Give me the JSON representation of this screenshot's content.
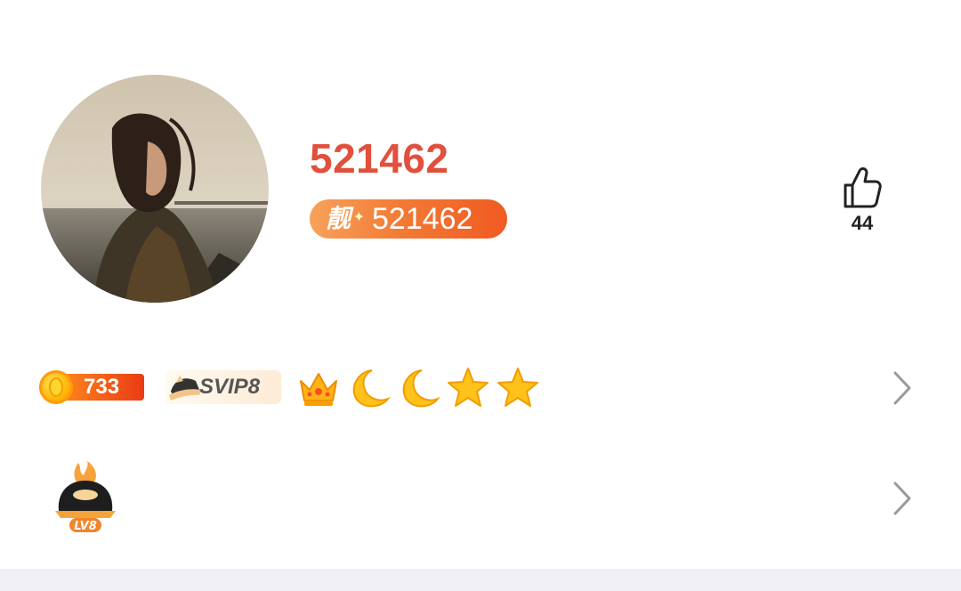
{
  "profile": {
    "username": "521462",
    "pretty_id": {
      "prefix": "靓",
      "number": "521462"
    },
    "likes": {
      "icon": "thumbs-up-icon",
      "count": "44"
    }
  },
  "badges": {
    "coin": {
      "icon": "gold-coin-icon",
      "value": "733"
    },
    "svip": {
      "icon": "svip-hat-icon",
      "label": "SVIP8"
    },
    "level_medals": [
      "crown-icon",
      "moon-icon",
      "moon-icon",
      "star-icon",
      "star-icon"
    ]
  },
  "fan_level": {
    "icon": "flame-cap-icon",
    "label": "LV8"
  },
  "colors": {
    "username": "#e0503d",
    "pretty_badge": "#f37b35",
    "chevron": "#9a9a9a",
    "bottom_strip": "#efeff4"
  }
}
